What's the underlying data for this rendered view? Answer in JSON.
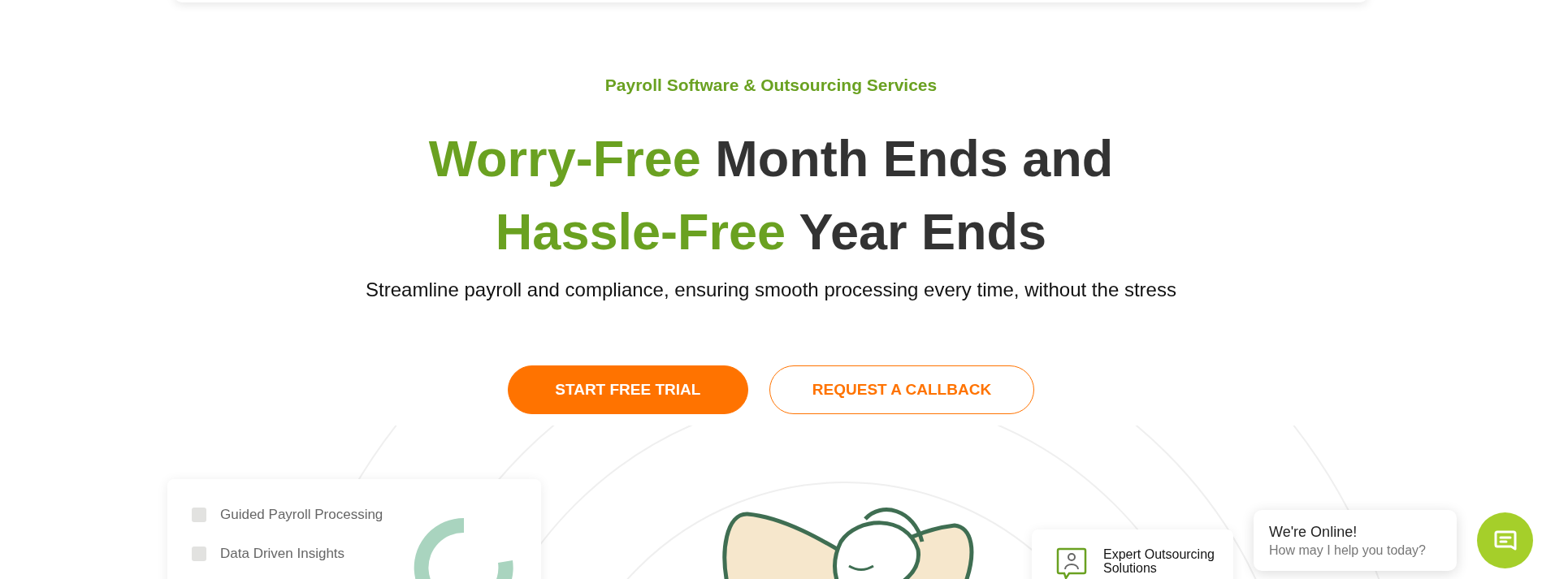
{
  "eyebrow": "Payroll Software & Outsourcing Services",
  "headline": [
    [
      {
        "text": "Worry-Free",
        "accent": true
      },
      {
        "text": " Month Ends and",
        "accent": false
      }
    ],
    [
      {
        "text": "Hassle-Free",
        "accent": true
      },
      {
        "text": " Year Ends",
        "accent": false
      }
    ]
  ],
  "subtitle": "Streamline payroll and compliance, ensuring smooth processing every time, without the stress",
  "buttons": [
    {
      "label": "START FREE TRIAL",
      "kind": "primary"
    },
    {
      "label": "REQUEST A CALLBACK",
      "kind": "outline"
    }
  ],
  "feature_card": {
    "items": [
      {
        "label": "Guided Payroll Processing",
        "checked": false
      },
      {
        "label": "Data Driven Insights",
        "checked": false
      }
    ]
  },
  "service_card": {
    "title": "Expert Outsourcing Solutions"
  },
  "chat": {
    "title": "We're Online!",
    "message": "How may I help you today?"
  }
}
